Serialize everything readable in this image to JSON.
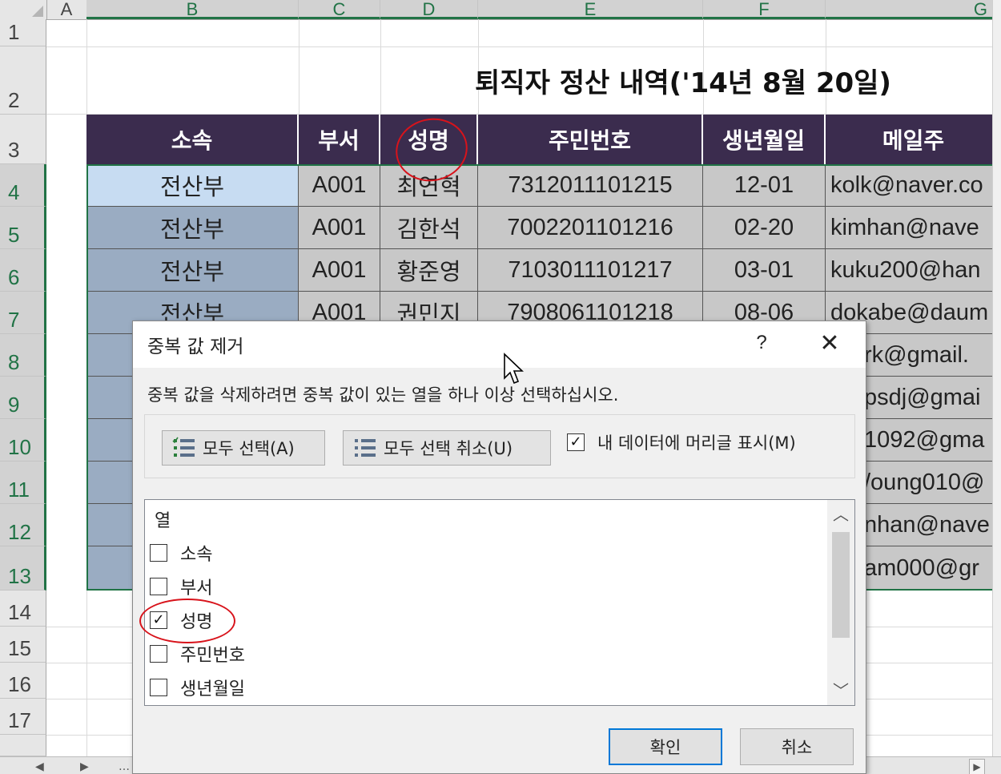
{
  "column_headers": [
    "A",
    "B",
    "C",
    "D",
    "E",
    "F",
    "G"
  ],
  "row_headers": [
    "1",
    "2",
    "3",
    "4",
    "5",
    "6",
    "7",
    "8",
    "9",
    "10",
    "11",
    "12",
    "13",
    "14",
    "15",
    "16",
    "17"
  ],
  "sheet_title": "퇴직자 정산 내역('14년 8월 20일)",
  "table": {
    "headers": [
      "소속",
      "부서",
      "성명",
      "주민번호",
      "생년월일",
      "메일주"
    ],
    "rows": [
      [
        "전산부",
        "A001",
        "최연혁",
        "7312011101215",
        "12-01",
        "kolk@naver.co"
      ],
      [
        "전산부",
        "A001",
        "김한석",
        "7002201101216",
        "02-20",
        "kimhan@nave"
      ],
      [
        "전산부",
        "A001",
        "황준영",
        "7103011101217",
        "03-01",
        "kuku200@han"
      ],
      [
        "전산부",
        "A001",
        "권민지",
        "7908061101218",
        "08-06",
        "dokabe@daum"
      ]
    ],
    "email_fragments": [
      "rk@gmail.",
      "psdj@gmai",
      "1092@gma",
      "/oung010@",
      "nhan@nave",
      "am000@gr"
    ]
  },
  "dialog": {
    "title": "중복 값 제거",
    "help": "?",
    "close": "✕",
    "instruction": "중복 값을 삭제하려면 중복 값이 있는 열을 하나 이상 선택하십시오.",
    "select_all": "모두 선택(A)",
    "unselect_all": "모두 선택 취소(U)",
    "my_data_has_headers": "내 데이터에 머리글 표시(M)",
    "my_data_has_headers_checked": true,
    "list_header": "열",
    "columns": [
      {
        "label": "소속",
        "checked": false
      },
      {
        "label": "부서",
        "checked": false
      },
      {
        "label": "성명",
        "checked": true
      },
      {
        "label": "주민번호",
        "checked": false
      },
      {
        "label": "생년월일",
        "checked": false
      }
    ],
    "ok": "확인",
    "cancel": "취소"
  },
  "colors": {
    "header_bg": "#3b2c4e",
    "dept_fill": "#9aacc2",
    "active_cell": "#c7dcf2",
    "data_fill": "#c8c8c8",
    "selection_border": "#217346",
    "annotation": "#d8131b"
  },
  "icons": [
    "select-all-icon",
    "unselect-all-icon",
    "close-icon",
    "help-icon",
    "scroll-up-icon",
    "scroll-down-icon",
    "mouse-cursor-icon"
  ]
}
